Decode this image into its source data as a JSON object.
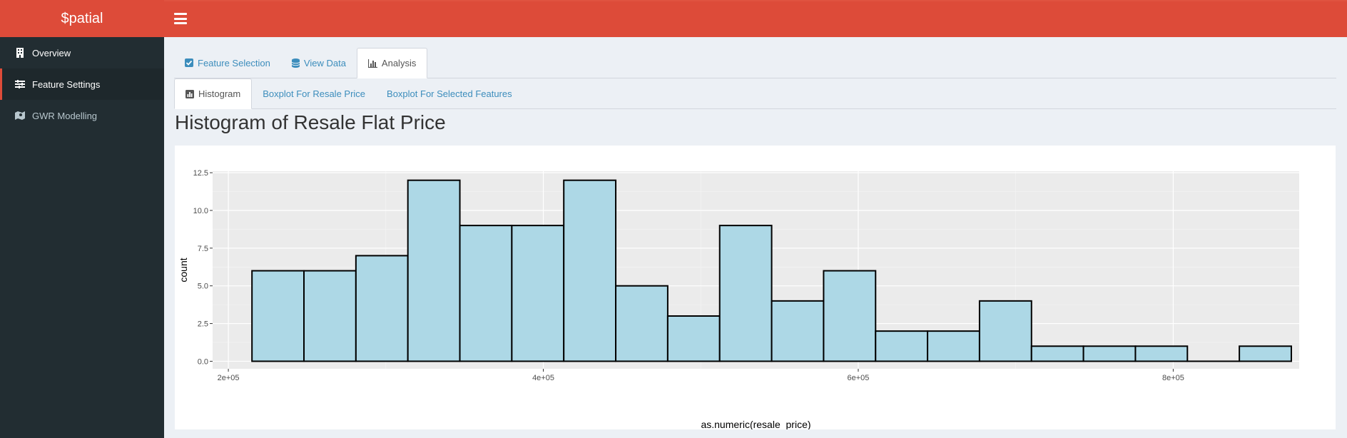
{
  "app": {
    "title": "$patial"
  },
  "sidebar": {
    "items": [
      {
        "label": "Overview",
        "icon": "building-icon",
        "active": false
      },
      {
        "label": "Feature Settings",
        "icon": "sliders-icon",
        "active": true
      },
      {
        "label": "GWR Modelling",
        "icon": "map-icon",
        "active": false
      }
    ]
  },
  "tabs": [
    {
      "label": "Feature Selection",
      "icon": "checkbox-icon",
      "active": false
    },
    {
      "label": "View Data",
      "icon": "database-icon",
      "active": false
    },
    {
      "label": "Analysis",
      "icon": "bar-chart-icon",
      "active": true
    }
  ],
  "subtabs": [
    {
      "label": "Histogram",
      "icon": "histogram-icon",
      "active": true
    },
    {
      "label": "Boxplot For Resale Price",
      "active": false
    },
    {
      "label": "Boxplot For Selected Features",
      "active": false
    }
  ],
  "page_title": "Histogram of Resale Flat Price",
  "colors": {
    "header": "#dd4b39",
    "sidebar": "#222d32",
    "link": "#3c8dbc",
    "panel_bg": "#ebebeb",
    "bar_fill": "#add8e6",
    "bar_stroke": "#000000"
  },
  "chart_data": {
    "type": "bar",
    "title": "",
    "xlabel": "as.numeric(resale_price)",
    "ylabel": "count",
    "xlim": [
      190000,
      880000
    ],
    "ylim": [
      -0.5,
      12.6
    ],
    "bin_width": 33000,
    "bin_start": 215000,
    "values": [
      6,
      6,
      7,
      12,
      9,
      9,
      12,
      5,
      3,
      9,
      4,
      6,
      2,
      2,
      4,
      1,
      1,
      1,
      0,
      1
    ],
    "x_ticks": [
      {
        "value": 200000,
        "label": "2e+05"
      },
      {
        "value": 400000,
        "label": "4e+05"
      },
      {
        "value": 600000,
        "label": "6e+05"
      },
      {
        "value": 800000,
        "label": "8e+05"
      }
    ],
    "y_ticks": [
      {
        "value": 0,
        "label": "0.0"
      },
      {
        "value": 2.5,
        "label": "2.5"
      },
      {
        "value": 5,
        "label": "5.0"
      },
      {
        "value": 7.5,
        "label": "7.5"
      },
      {
        "value": 10,
        "label": "10.0"
      },
      {
        "value": 12.5,
        "label": "12.5"
      }
    ],
    "grid": true
  }
}
